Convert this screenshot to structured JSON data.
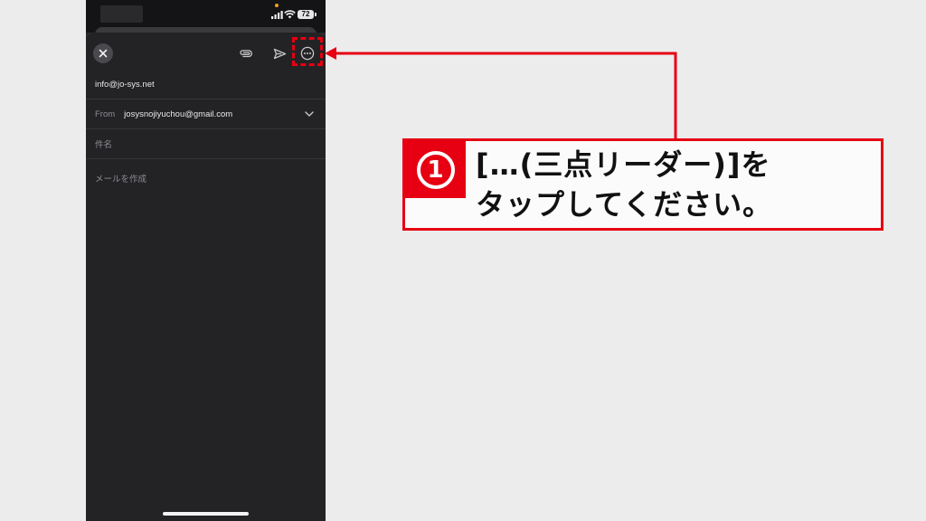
{
  "status_bar": {
    "battery": "72"
  },
  "compose": {
    "to": "info@jo-sys.net",
    "from_label": "From",
    "from_value": "josysnojiyuchou@gmail.com",
    "subject_placeholder": "件名",
    "body_placeholder": "メールを作成"
  },
  "instruction": {
    "step": "1",
    "line1": "[…(三点リーダー)]を",
    "line2": "タップしてください。"
  },
  "colors": {
    "accent": "#e60012",
    "sheet": "#232326",
    "phone_bg": "#2a2a2d"
  },
  "icons": {
    "close": "close-icon",
    "attach": "paperclip-icon",
    "send": "send-icon",
    "more": "more-dots-icon",
    "expand": "chevron-down-icon"
  }
}
